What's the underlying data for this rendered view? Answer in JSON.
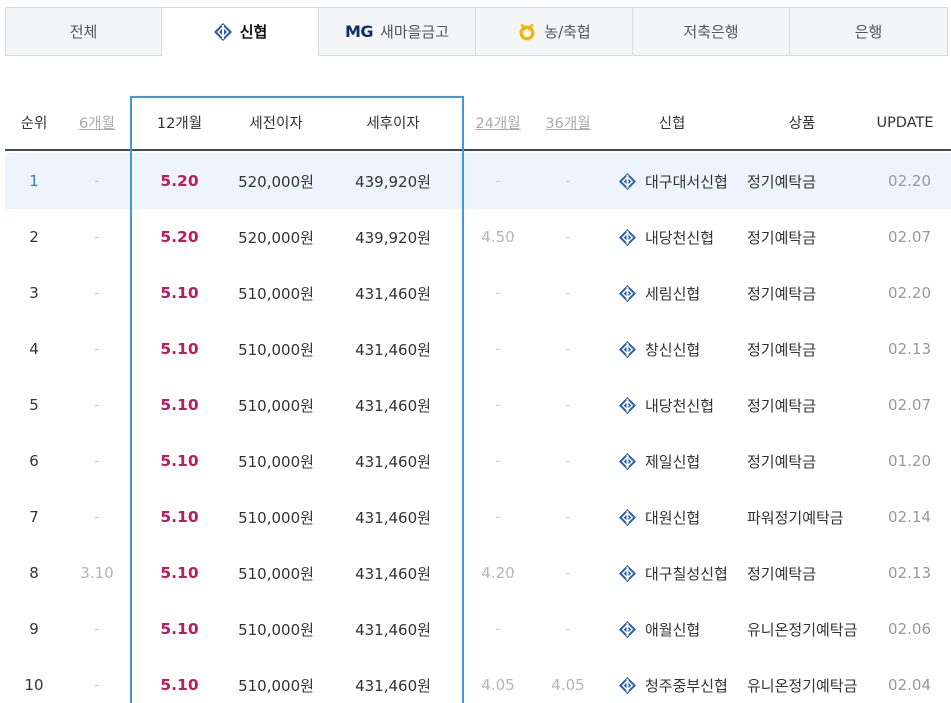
{
  "tabs": [
    {
      "label": "전체",
      "icon": null
    },
    {
      "label": "신협",
      "icon": "shinhyup-logo-icon",
      "active": true
    },
    {
      "label": "새마을금고",
      "prefix": "MG",
      "icon": "mg-logo"
    },
    {
      "label": "농/축협",
      "icon": "nh-logo-icon"
    },
    {
      "label": "저축은행",
      "icon": null
    },
    {
      "label": "은행",
      "icon": null
    }
  ],
  "table": {
    "headers": {
      "rank": "순위",
      "m6": "6개월",
      "m12": "12개월",
      "pre_tax": "세전이자",
      "post_tax": "세후이자",
      "m24": "24개월",
      "m36": "36개월",
      "bank": "신협",
      "product": "상품",
      "update": "UPDATE"
    },
    "rows": [
      {
        "rank": "1",
        "m6": "-",
        "m12": "5.20",
        "pre_tax": "520,000원",
        "post_tax": "439,920원",
        "m24": "-",
        "m36": "-",
        "bank": "대구대서신협",
        "product": "정기예탁금",
        "update": "02.20"
      },
      {
        "rank": "2",
        "m6": "-",
        "m12": "5.20",
        "pre_tax": "520,000원",
        "post_tax": "439,920원",
        "m24": "4.50",
        "m36": "-",
        "bank": "내당천신협",
        "product": "정기예탁금",
        "update": "02.07"
      },
      {
        "rank": "3",
        "m6": "-",
        "m12": "5.10",
        "pre_tax": "510,000원",
        "post_tax": "431,460원",
        "m24": "-",
        "m36": "-",
        "bank": "세림신협",
        "product": "정기예탁금",
        "update": "02.20"
      },
      {
        "rank": "4",
        "m6": "-",
        "m12": "5.10",
        "pre_tax": "510,000원",
        "post_tax": "431,460원",
        "m24": "-",
        "m36": "-",
        "bank": "창신신협",
        "product": "정기예탁금",
        "update": "02.13"
      },
      {
        "rank": "5",
        "m6": "-",
        "m12": "5.10",
        "pre_tax": "510,000원",
        "post_tax": "431,460원",
        "m24": "-",
        "m36": "-",
        "bank": "내당천신협",
        "product": "정기예탁금",
        "update": "02.07"
      },
      {
        "rank": "6",
        "m6": "-",
        "m12": "5.10",
        "pre_tax": "510,000원",
        "post_tax": "431,460원",
        "m24": "-",
        "m36": "-",
        "bank": "제일신협",
        "product": "정기예탁금",
        "update": "01.20"
      },
      {
        "rank": "7",
        "m6": "-",
        "m12": "5.10",
        "pre_tax": "510,000원",
        "post_tax": "431,460원",
        "m24": "-",
        "m36": "-",
        "bank": "대원신협",
        "product": "파워정기예탁금",
        "update": "02.14"
      },
      {
        "rank": "8",
        "m6": "3.10",
        "m12": "5.10",
        "pre_tax": "510,000원",
        "post_tax": "431,460원",
        "m24": "4.20",
        "m36": "-",
        "bank": "대구칠성신협",
        "product": "정기예탁금",
        "update": "02.13"
      },
      {
        "rank": "9",
        "m6": "-",
        "m12": "5.10",
        "pre_tax": "510,000원",
        "post_tax": "431,460원",
        "m24": "-",
        "m36": "-",
        "bank": "애월신협",
        "product": "유니온정기예탁금",
        "update": "02.06"
      },
      {
        "rank": "10",
        "m6": "-",
        "m12": "5.10",
        "pre_tax": "510,000원",
        "post_tax": "431,460원",
        "m24": "4.05",
        "m36": "4.05",
        "bank": "청주중부신협",
        "product": "유니온정기예탁금",
        "update": "02.04"
      }
    ],
    "highlighted_row": 0
  },
  "colors": {
    "rate_accent": "#c2185b",
    "focus_border": "#3d9ae0",
    "header_rule": "#3c4a5c",
    "row_highlight": "#edf4fb",
    "shinhyup_blue": "#2f5fa8"
  }
}
